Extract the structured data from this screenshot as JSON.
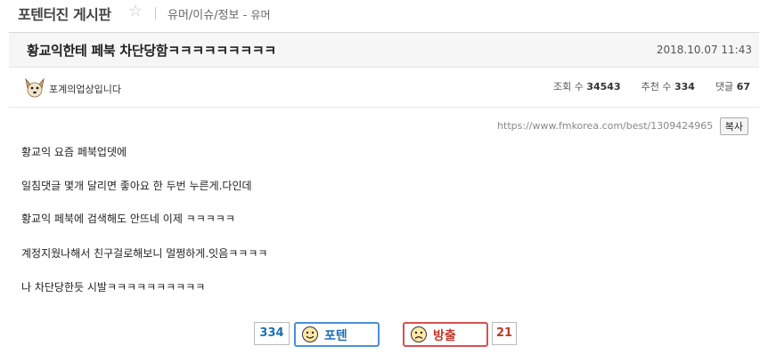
{
  "board": {
    "title": "포텐터진 게시판",
    "breadcrumb": "유머/이슈/정보",
    "separator": "-",
    "sub_category": "유머"
  },
  "post": {
    "title": "황교익한테 페북 차단당함ㅋㅋㅋㅋㅋㅋㅋㅋㅋ",
    "date": "2018.10.07 11:43",
    "author": "포계의업상입니다",
    "stats": {
      "views_label": "조회 수",
      "views": "34543",
      "votes_label": "추천 수",
      "votes": "334",
      "comments_label": "댓글",
      "comments": "67"
    },
    "url": "https://www.fmkorea.com/best/1309424965",
    "copy_label": "복사",
    "lines": [
      "황교익 요즘 페북업뎃에",
      "일침댓글 몇개 달리면 좋아요 한 두번 누른게.다인데",
      "황교익 페북에 검색해도 안뜨네 이제 ㅋㅋㅋㅋㅋ",
      "계정지웠나해서 친구걸로해보니 멀쩡하게.잇음ㅋㅋㅋㅋ",
      "나 차단당한듯 시발ㅋㅋㅋㅋㅋㅋㅋㅋㅋㅋ"
    ]
  },
  "vote": {
    "up_count": "334",
    "up_label": "포텐",
    "down_label": "방출",
    "down_count": "21"
  },
  "colors": {
    "up": "#1e6fb6",
    "down": "#c0392b",
    "header_bg": "#f6f6f6"
  },
  "icons": [
    "star-icon",
    "dog-avatar-icon",
    "vote-up-face-icon",
    "vote-down-face-icon"
  ]
}
